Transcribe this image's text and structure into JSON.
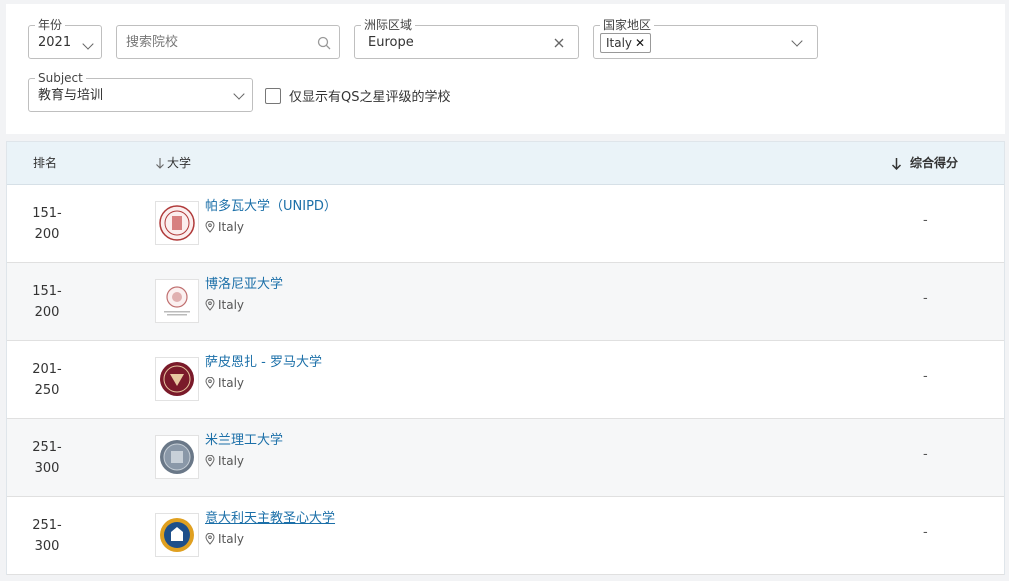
{
  "filters": {
    "year": {
      "legend": "年份",
      "value": "2021"
    },
    "search": {
      "placeholder": "搜索院校"
    },
    "region": {
      "legend": "洲际区域",
      "value": "Europe"
    },
    "country": {
      "legend": "国家地区",
      "chip": "Italy"
    },
    "subject": {
      "legend": "Subject",
      "value": "教育与培训"
    },
    "qs_stars": {
      "label": "仅显示有QS之星评级的学校",
      "checked": false
    }
  },
  "table": {
    "headers": {
      "rank": "排名",
      "university": "大学",
      "score": "综合得分"
    },
    "rows": [
      {
        "rank_top": "151-",
        "rank_bottom": "200",
        "name": "帕多瓦大学（UNIPD）",
        "country": "Italy",
        "score": "-",
        "logo_color": "#b03a3a"
      },
      {
        "rank_top": "151-",
        "rank_bottom": "200",
        "name": "博洛尼亚大学",
        "country": "Italy",
        "score": "-",
        "logo_color": "#c07070"
      },
      {
        "rank_top": "201-",
        "rank_bottom": "250",
        "name": "萨皮恩扎 - 罗马大学",
        "country": "Italy",
        "score": "-",
        "logo_color": "#7a1a2a"
      },
      {
        "rank_top": "251-",
        "rank_bottom": "300",
        "name": "米兰理工大学",
        "country": "Italy",
        "score": "-",
        "logo_color": "#5a6a7a"
      },
      {
        "rank_top": "251-",
        "rank_bottom": "300",
        "name": "意大利天主教圣心大学",
        "country": "Italy",
        "score": "-",
        "logo_color": "#e0a020"
      }
    ]
  },
  "colors": {
    "link": "#1b6fa8",
    "header_bg": "#eaf3f8"
  }
}
